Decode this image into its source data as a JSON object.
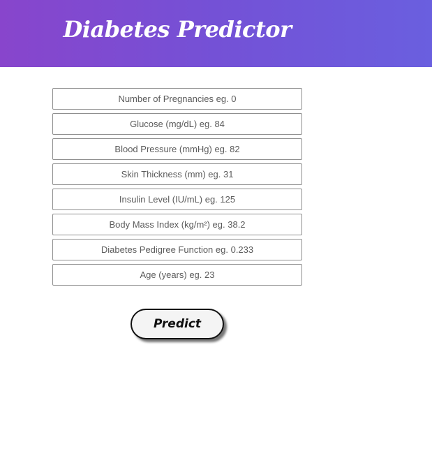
{
  "header": {
    "title": "Diabetes Predictor"
  },
  "form": {
    "fields": [
      {
        "placeholder": "Number of Pregnancies eg. 0",
        "value": ""
      },
      {
        "placeholder": "Glucose (mg/dL) eg. 84",
        "value": ""
      },
      {
        "placeholder": "Blood Pressure (mmHg) eg. 82",
        "value": ""
      },
      {
        "placeholder": "Skin Thickness (mm) eg. 31",
        "value": ""
      },
      {
        "placeholder": "Insulin Level (IU/mL) eg. 125",
        "value": ""
      },
      {
        "placeholder": "Body Mass Index (kg/m²) eg. 38.2",
        "value": ""
      },
      {
        "placeholder": "Diabetes Pedigree Function eg. 0.233",
        "value": ""
      },
      {
        "placeholder": "Age (years) eg. 23",
        "value": ""
      }
    ],
    "submit_label": "Predict"
  },
  "colors": {
    "header_gradient_start": "#8845cc",
    "header_gradient_end": "#6a5fdf",
    "title_text": "#ffffff",
    "button_background": "#f4f4f4",
    "button_border": "#111111"
  }
}
